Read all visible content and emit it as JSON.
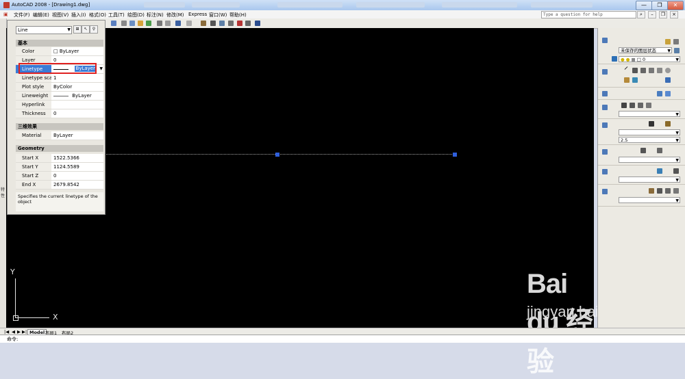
{
  "window": {
    "title": "AutoCAD 2008 - [Drawing1.dwg]",
    "help_placeholder": "Type a question for help",
    "controls": [
      "—",
      "❐",
      "✕"
    ]
  },
  "menu": [
    "文件(F)",
    "编辑(E)",
    "视图(V)",
    "插入(I)",
    "格式(O)",
    "工具(T)",
    "绘图(D)",
    "标注(N)",
    "修改(M)",
    "Express",
    "窗口(W)",
    "帮助(H)"
  ],
  "properties_palette": {
    "object_type": "Line",
    "sections": {
      "general": "基本",
      "three_d": "三维效果",
      "geometry": "Geometry"
    },
    "general_rows": [
      {
        "key": "Color",
        "value": "□ ByLayer"
      },
      {
        "key": "Layer",
        "value": "0"
      },
      {
        "key": "Linetype",
        "value": "ByLayer"
      },
      {
        "key": "Linetype scale",
        "value": "1"
      },
      {
        "key": "Plot style",
        "value": "ByColor"
      },
      {
        "key": "Lineweight",
        "value": "ByLayer"
      },
      {
        "key": "Hyperlink",
        "value": ""
      },
      {
        "key": "Thickness",
        "value": "0"
      }
    ],
    "three_d_rows": [
      {
        "key": "Material",
        "value": "ByLayer"
      }
    ],
    "geometry_rows": [
      {
        "key": "Start X",
        "value": "1522.5366"
      },
      {
        "key": "Start Y",
        "value": "1124.5589"
      },
      {
        "key": "Start Z",
        "value": "0"
      },
      {
        "key": "End X",
        "value": "2679.8542"
      }
    ],
    "description": "Specifies the current linetype of the object",
    "side_label": "特性"
  },
  "right_panel": {
    "layer_state": "未保存的图层状态",
    "layer_name": "0",
    "dim_scale": "2.5"
  },
  "layout_tabs": [
    "Model",
    "布局1",
    "布局2"
  ],
  "command_prompt": "命令:",
  "ucs": {
    "y": "Y",
    "x": "X"
  },
  "watermark": {
    "brand": "Bai du 经验",
    "url": "jingyan.baidu.com"
  },
  "colors": {
    "selection": "#3b7bd6",
    "grip": "#2f5fdc",
    "highlight_box": "#e02020",
    "canvas": "#000000"
  }
}
